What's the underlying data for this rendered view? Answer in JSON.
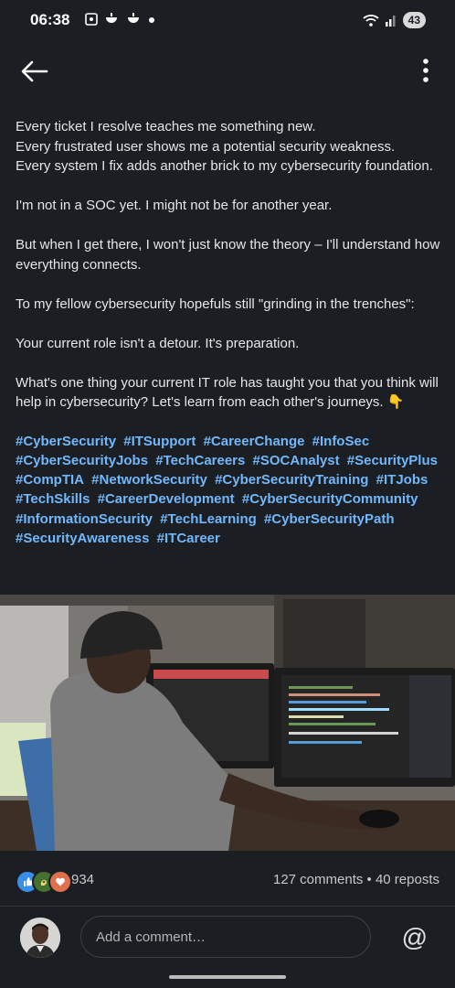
{
  "status": {
    "time": "06:38",
    "battery": "43"
  },
  "post": {
    "paragraphs": [
      "Every ticket I resolve teaches me something new.\nEvery frustrated user shows me a potential security weakness.\nEvery system I fix adds another brick to my cybersecurity foundation.",
      "I'm not in a SOC yet. I might not be for another year.",
      "But when I get there, I won't just know the theory – I'll understand how everything connects.",
      "To my fellow cybersecurity hopefuls still \"grinding in the trenches\":",
      "Your current role isn't a detour. It's preparation.",
      "What's one thing your current IT role has taught you that you think will help in cybersecurity? Let's learn from each other's journeys. 👇"
    ],
    "hashtags": [
      "#CyberSecurity",
      "#ITSupport",
      "#CareerChange",
      "#InfoSec",
      "#CyberSecurityJobs",
      "#TechCareers",
      "#SOCAnalyst",
      "#SecurityPlus",
      "#CompTIA",
      "#NetworkSecurity",
      "#CyberSecurityTraining",
      "#ITJobs",
      "#TechSkills",
      "#CareerDevelopment",
      "#CyberSecurityCommunity",
      "#InformationSecurity",
      "#TechLearning",
      "#CyberSecurityPath",
      "#SecurityAwareness",
      "#ITCareer"
    ]
  },
  "engagement": {
    "reaction_count": "934",
    "comments_reposts": "127 comments • 40 reposts",
    "reaction_icons": [
      "like-icon",
      "celebrate-icon",
      "love-icon"
    ]
  },
  "comment": {
    "placeholder": "Add a comment…",
    "mention_symbol": "@"
  },
  "colors": {
    "background": "#1b1f23",
    "hashtag": "#71b7fb",
    "like": "#378fe9",
    "celebrate": "#44712e",
    "love": "#df704d"
  }
}
